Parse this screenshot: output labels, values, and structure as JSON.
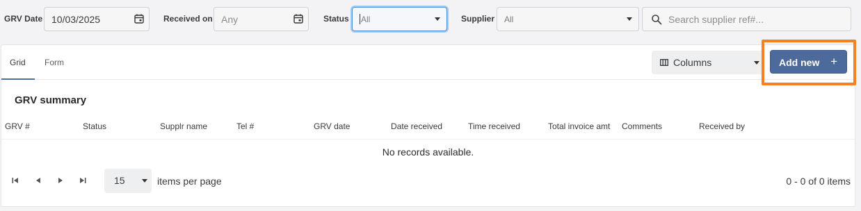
{
  "filters": {
    "grv_date": {
      "label": "GRV Date",
      "value": "10/03/2025"
    },
    "received_on": {
      "label": "Received on",
      "placeholder": "Any"
    },
    "status": {
      "label": "Status",
      "value": "All"
    },
    "supplier": {
      "label": "Supplier",
      "value": "All"
    },
    "search": {
      "placeholder": "Search supplier ref#..."
    }
  },
  "tabs": [
    {
      "label": "Grid",
      "active": true
    },
    {
      "label": "Form",
      "active": false
    }
  ],
  "toolbar": {
    "columns_label": "Columns",
    "add_new_label": "Add new",
    "add_new_icon": "+"
  },
  "grid": {
    "title": "GRV summary",
    "columns": [
      "GRV #",
      "Status",
      "Supplr name",
      "Tel #",
      "GRV date",
      "Date received",
      "Time received",
      "Total invoice amt",
      "Comments",
      "Received by"
    ],
    "empty_message": "No records available."
  },
  "pager": {
    "page_size": "15",
    "per_page_label": "items per page",
    "info": "0 - 0 of 0 items"
  },
  "colors": {
    "accent": "#4d6a9c",
    "highlight": "#f58220",
    "focus": "#4a90d9"
  }
}
